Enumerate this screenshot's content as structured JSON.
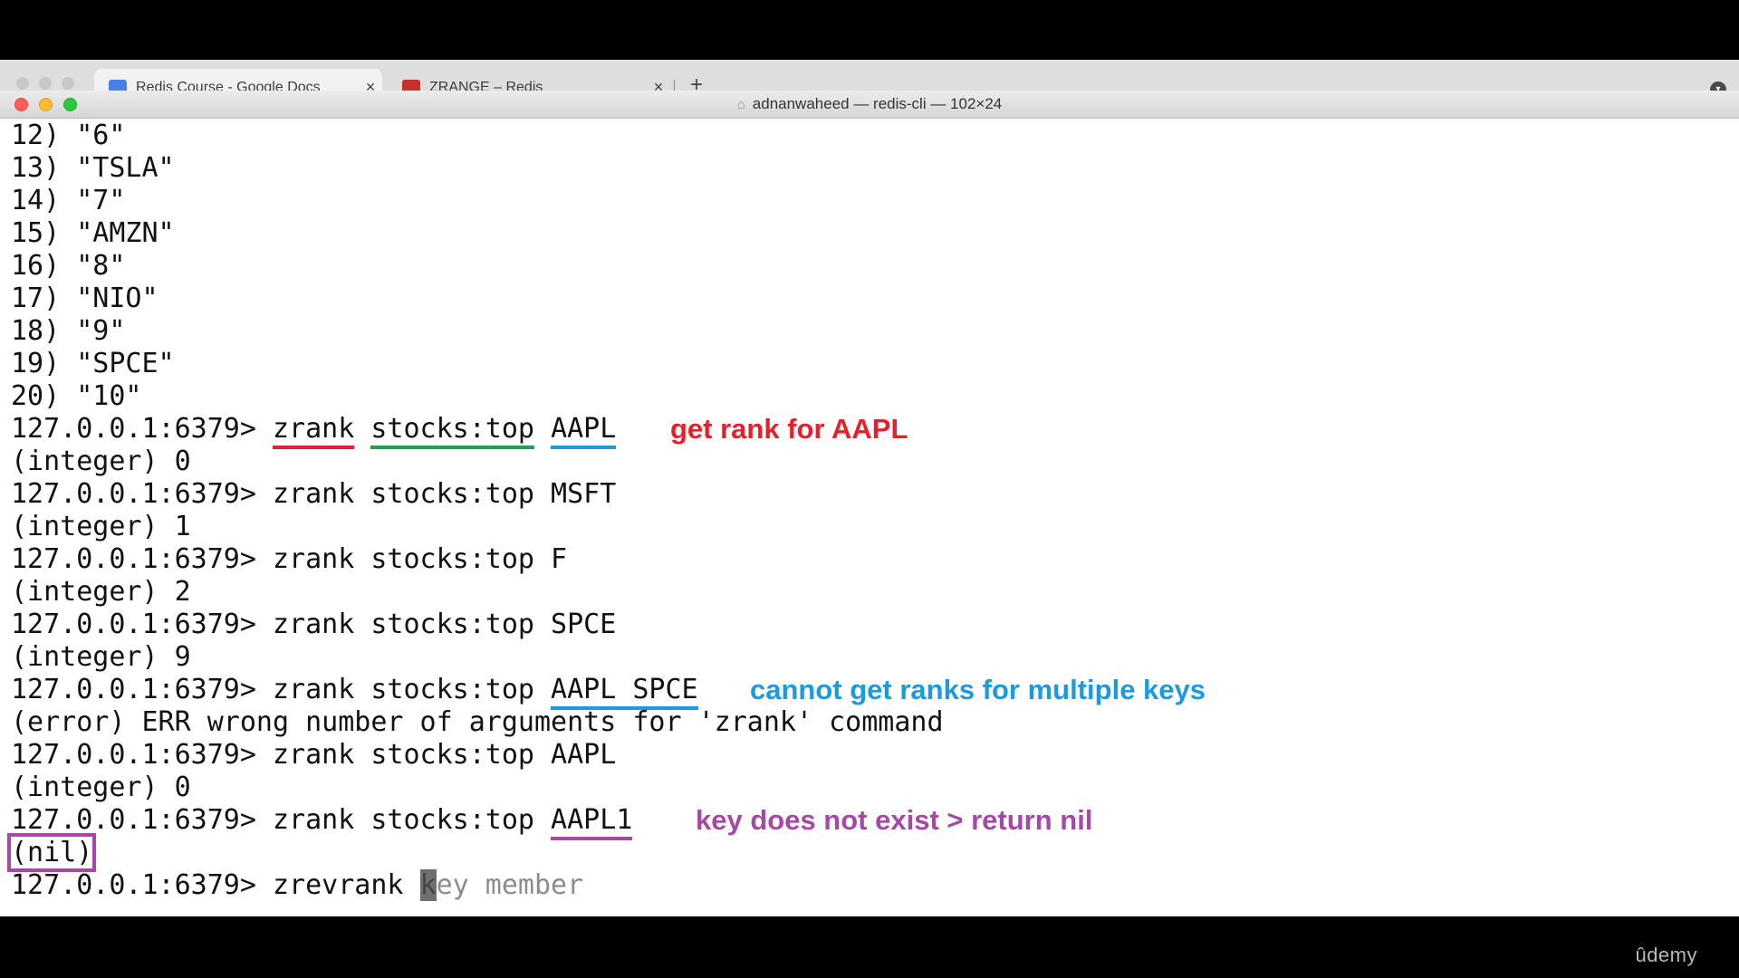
{
  "browser": {
    "tabs": [
      {
        "label": "Redis Course - Google Docs",
        "icon": "google-docs-icon",
        "close": "×",
        "icon_color": "#4a7fe8"
      },
      {
        "label": "ZRANGE – Redis",
        "icon": "redis-icon",
        "close": "×",
        "icon_color": "#c8302c"
      }
    ],
    "new_tab": "+",
    "menu": "▾"
  },
  "window": {
    "title": "adnanwaheed — redis-cli — 102×24",
    "home_icon": "⌂"
  },
  "terminal": {
    "prompt": "127.0.0.1:6379>",
    "output_list": [
      {
        "index": "12)",
        "value": "\"6\""
      },
      {
        "index": "13)",
        "value": "\"TSLA\""
      },
      {
        "index": "14)",
        "value": "\"7\""
      },
      {
        "index": "15)",
        "value": "\"AMZN\""
      },
      {
        "index": "16)",
        "value": "\"8\""
      },
      {
        "index": "17)",
        "value": "\"NIO\""
      },
      {
        "index": "18)",
        "value": "\"9\""
      },
      {
        "index": "19)",
        "value": "\"SPCE\""
      },
      {
        "index": "20)",
        "value": "\"10\""
      }
    ],
    "cmd_rank_aapl": {
      "cmd": "zrank",
      "key": "stocks:top",
      "member": "AAPL"
    },
    "result_0": "(integer) 0",
    "cmd_msft": "zrank stocks:top MSFT",
    "result_1": "(integer) 1",
    "cmd_f": "zrank stocks:top F",
    "result_2": "(integer) 2",
    "cmd_spce": "zrank stocks:top SPCE",
    "result_9": "(integer) 9",
    "cmd_multi": {
      "prefix": "zrank stocks:top",
      "members": "AAPL SPCE"
    },
    "error": "(error) ERR wrong number of arguments for 'zrank' command",
    "cmd_aapl_again": "zrank stocks:top AAPL",
    "result_0_again": "(integer) 0",
    "cmd_aapl1": {
      "prefix": "zrank stocks:top",
      "member": "AAPL1"
    },
    "nil": "(nil)",
    "current_cmd": "zrevrank",
    "cursor_char": "k",
    "hint_rest": "ey member"
  },
  "annotations": {
    "rank": "get rank for AAPL",
    "multiple": "cannot get ranks for multiple keys",
    "nil": "key does not exist > return nil"
  },
  "colors": {
    "red": "#e5202a",
    "green": "#22a04b",
    "blue": "#1b9ae0",
    "purple": "#a548a6"
  },
  "watermark": "ûdemy"
}
